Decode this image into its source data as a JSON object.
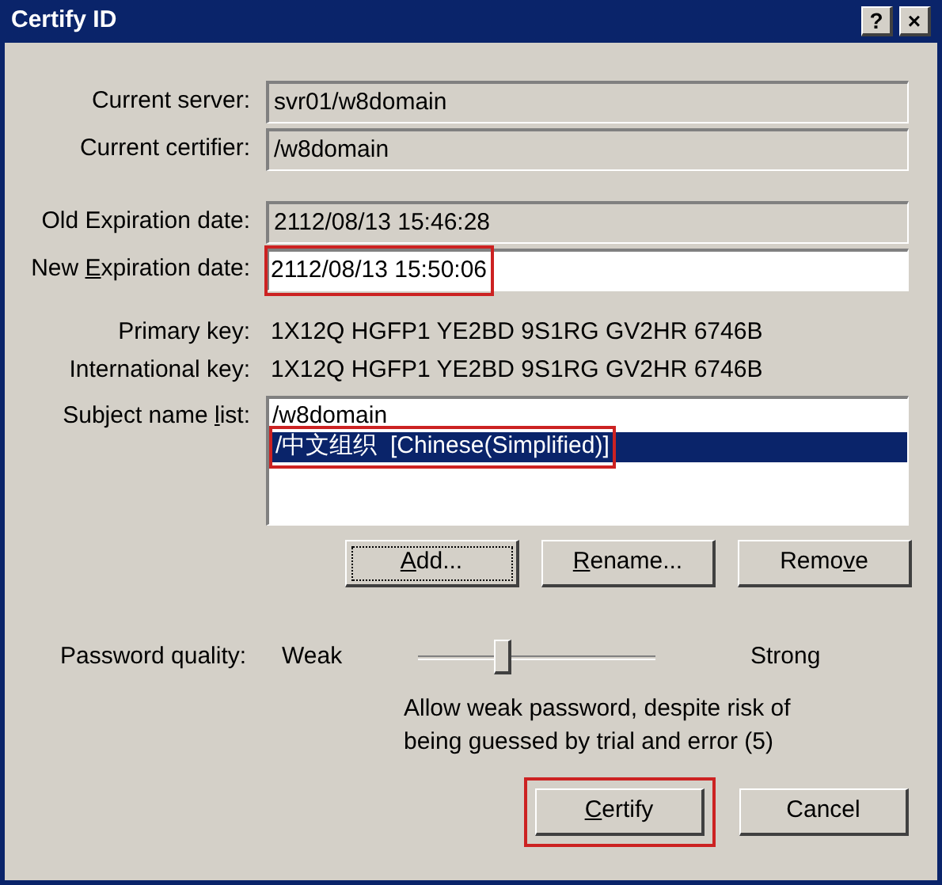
{
  "window": {
    "title": "Certify ID",
    "title_buttons": [
      "?",
      "×"
    ]
  },
  "info_fields": [
    {
      "label": [
        {
          "text": "Current server:",
          "underlined": false
        }
      ],
      "value": "svr01/w8domain",
      "editable": false,
      "highlighted": false
    },
    {
      "label": [
        {
          "text": "Current certifier:",
          "underlined": false
        }
      ],
      "value": "/w8domain",
      "editable": false,
      "highlighted": false
    }
  ],
  "date_fields": [
    {
      "label": [
        {
          "text": "Old Expiration date:",
          "underlined": false
        }
      ],
      "value": "2112/08/13 15:46:28",
      "editable": false,
      "highlighted": false
    },
    {
      "label": [
        {
          "text": "New ",
          "underlined": false
        },
        {
          "text": "E",
          "underlined": true
        },
        {
          "text": "xpiration date:",
          "underlined": false
        }
      ],
      "value": "2112/08/13 15:50:06",
      "editable": true,
      "highlighted": true
    }
  ],
  "keys": [
    {
      "label": "Primary key:",
      "value": "1X12Q HGFP1 YE2BD 9S1RG GV2HR 6746B"
    },
    {
      "label": "International key:",
      "value": "1X12Q HGFP1 YE2BD 9S1RG GV2HR 6746B"
    }
  ],
  "subject_list": {
    "label": [
      {
        "text": "Subject name ",
        "underlined": false
      },
      {
        "text": "l",
        "underlined": true
      },
      {
        "text": "ist:",
        "underlined": false
      }
    ],
    "items": [
      {
        "text": "/w8domain",
        "selected": false,
        "highlighted": false
      },
      {
        "text": "/中文组织  [Chinese(Simplified)]",
        "selected": true,
        "highlighted": true
      }
    ]
  },
  "list_buttons": [
    {
      "label": [
        {
          "text": "A",
          "underlined": true
        },
        {
          "text": "dd...",
          "underlined": false
        }
      ],
      "focused": true
    },
    {
      "label": [
        {
          "text": "R",
          "underlined": true
        },
        {
          "text": "ename...",
          "underlined": false
        }
      ],
      "focused": false
    },
    {
      "label": [
        {
          "text": "Remo",
          "underlined": false
        },
        {
          "text": "v",
          "underlined": true
        },
        {
          "text": "e",
          "underlined": false
        }
      ],
      "focused": false
    }
  ],
  "password_quality": {
    "label": "Password quality:",
    "min_label": "Weak",
    "max_label": "Strong",
    "level": 0.35,
    "note": "Allow weak password, despite risk of being guessed by trial and error (5)"
  },
  "dialog_buttons": [
    {
      "label": [
        {
          "text": "C",
          "underlined": true
        },
        {
          "text": "ertify",
          "underlined": false
        }
      ],
      "highlighted": true
    },
    {
      "label": [
        {
          "text": "Cancel",
          "underlined": false
        }
      ],
      "highlighted": false
    }
  ]
}
